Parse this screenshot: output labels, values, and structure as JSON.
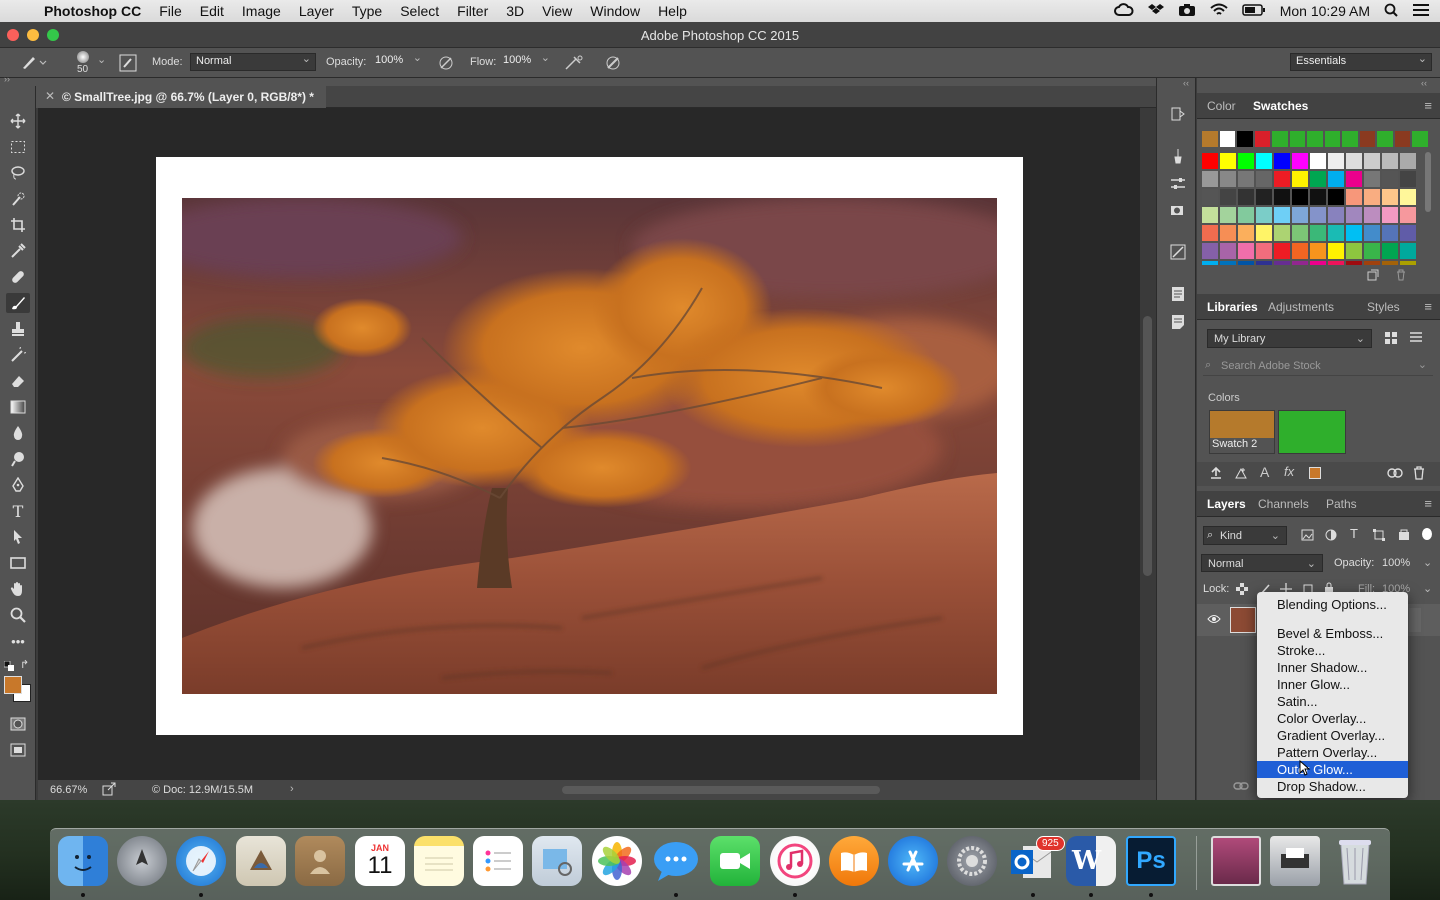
{
  "menubar": {
    "app_name": "Photoshop CC",
    "items": [
      "File",
      "Edit",
      "Image",
      "Layer",
      "Type",
      "Select",
      "Filter",
      "3D",
      "View",
      "Window",
      "Help"
    ],
    "clock": "Mon 10:29 AM"
  },
  "window": {
    "title": "Adobe Photoshop CC 2015"
  },
  "options": {
    "brush_size": "50",
    "mode_label": "Mode:",
    "mode_value": "Normal",
    "opacity_label": "Opacity:",
    "opacity_value": "100%",
    "flow_label": "Flow:",
    "flow_value": "100%",
    "workspace": "Essentials"
  },
  "document": {
    "tab_title": "© SmallTree.jpg @ 66.7% (Layer 0, RGB/8*) *",
    "zoom": "66.67%",
    "doc_size": "© Doc: 12.9M/15.5M"
  },
  "color_panel": {
    "tabs": [
      "Color",
      "Swatches"
    ],
    "active_tab": "Swatches"
  },
  "libraries_panel": {
    "tabs": [
      "Libraries",
      "Adjustments",
      "Styles"
    ],
    "library": "My Library",
    "search_placeholder": "Search Adobe Stock",
    "colors_heading": "Colors",
    "swatch_label": "Swatch 2",
    "swatch_colors": [
      "#b57a2c",
      "#2faf2c"
    ]
  },
  "layers_panel": {
    "tabs": [
      "Layers",
      "Channels",
      "Paths"
    ],
    "kind": "Kind",
    "blend_mode": "Normal",
    "opacity_label": "Opacity:",
    "opacity_value": "100%",
    "lock_label": "Lock:",
    "fill_label": "Fill:",
    "fill_value": "100%"
  },
  "context_menu": {
    "items": [
      "Blending Options...",
      "Bevel & Emboss...",
      "Stroke...",
      "Inner Shadow...",
      "Inner Glow...",
      "Satin...",
      "Color Overlay...",
      "Gradient Overlay...",
      "Pattern Overlay...",
      "Outer Glow...",
      "Drop Shadow..."
    ],
    "selected": "Outer Glow..."
  },
  "dock": {
    "calendar_month": "JAN",
    "calendar_day": "11",
    "outlook_badge": "925",
    "photoshop_label": "Ps",
    "word_label": "W"
  },
  "colors": {
    "foreground": "#c8782a",
    "background": "#ffffff",
    "menu_highlight": "#1f5fd6"
  }
}
